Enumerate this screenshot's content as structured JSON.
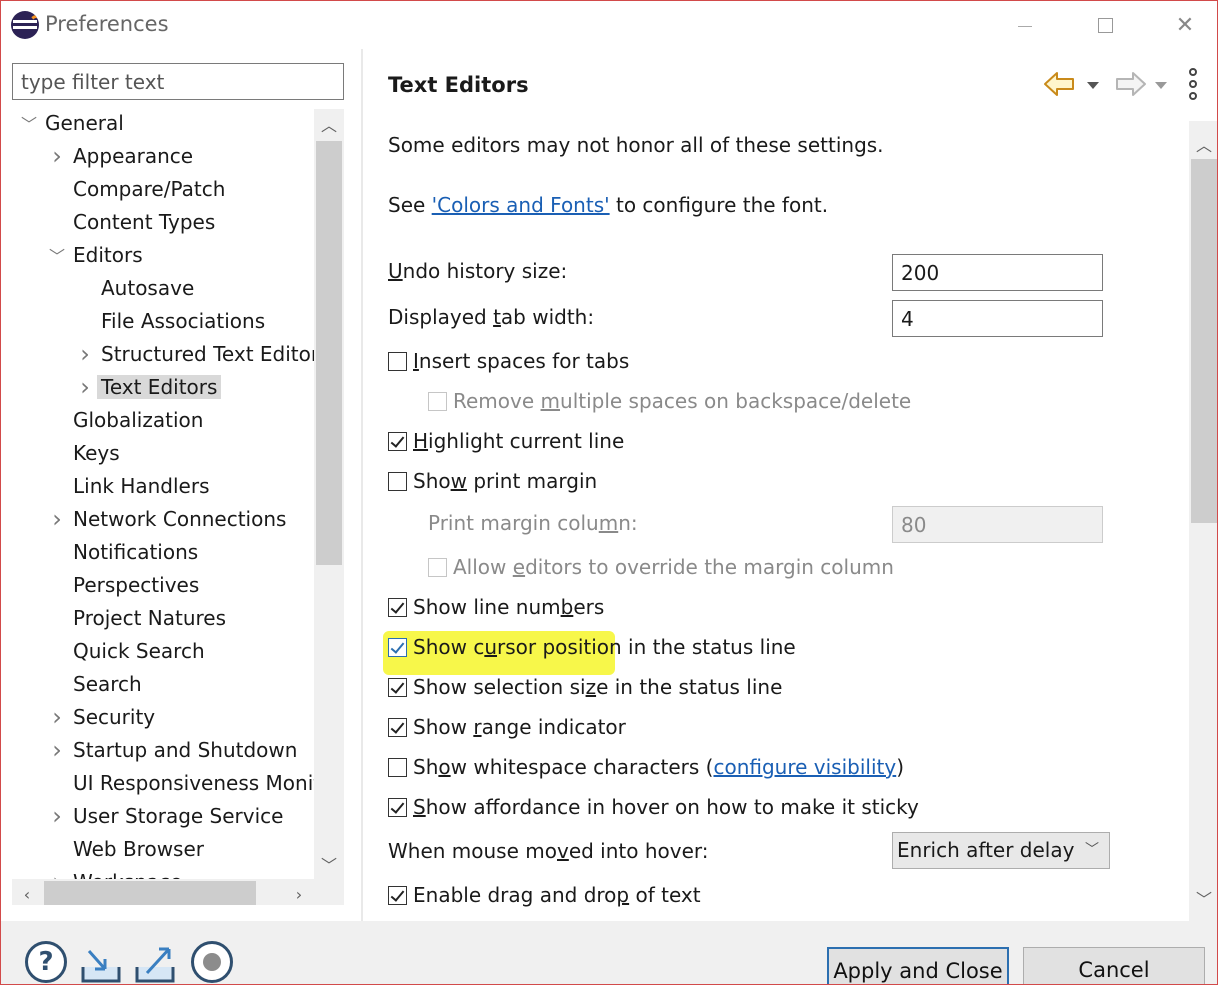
{
  "window": {
    "title": "Preferences"
  },
  "filter": {
    "placeholder": "type filter text"
  },
  "tree": {
    "items": [
      {
        "label": "General",
        "level": 0,
        "state": "expanded"
      },
      {
        "label": "Appearance",
        "level": 1,
        "state": "collapsed"
      },
      {
        "label": "Compare/Patch",
        "level": 1,
        "state": "leaf"
      },
      {
        "label": "Content Types",
        "level": 1,
        "state": "leaf"
      },
      {
        "label": "Editors",
        "level": 1,
        "state": "expanded"
      },
      {
        "label": "Autosave",
        "level": 2,
        "state": "leaf"
      },
      {
        "label": "File Associations",
        "level": 2,
        "state": "leaf"
      },
      {
        "label": "Structured Text Editors",
        "level": 2,
        "state": "collapsed"
      },
      {
        "label": "Text Editors",
        "level": 2,
        "state": "collapsed",
        "selected": true
      },
      {
        "label": "Globalization",
        "level": 1,
        "state": "leaf"
      },
      {
        "label": "Keys",
        "level": 1,
        "state": "leaf"
      },
      {
        "label": "Link Handlers",
        "level": 1,
        "state": "leaf"
      },
      {
        "label": "Network Connections",
        "level": 1,
        "state": "collapsed"
      },
      {
        "label": "Notifications",
        "level": 1,
        "state": "leaf"
      },
      {
        "label": "Perspectives",
        "level": 1,
        "state": "leaf"
      },
      {
        "label": "Project Natures",
        "level": 1,
        "state": "leaf"
      },
      {
        "label": "Quick Search",
        "level": 1,
        "state": "leaf"
      },
      {
        "label": "Search",
        "level": 1,
        "state": "leaf"
      },
      {
        "label": "Security",
        "level": 1,
        "state": "collapsed"
      },
      {
        "label": "Startup and Shutdown",
        "level": 1,
        "state": "collapsed"
      },
      {
        "label": "UI Responsiveness Monito",
        "level": 1,
        "state": "leaf"
      },
      {
        "label": "User Storage Service",
        "level": 1,
        "state": "collapsed"
      },
      {
        "label": "Web Browser",
        "level": 1,
        "state": "leaf"
      },
      {
        "label": "Workspace",
        "level": 1,
        "state": "collapsed"
      }
    ]
  },
  "page": {
    "title": "Text Editors",
    "intro": "Some editors may not honor all of these settings.",
    "see_prefix": "See ",
    "colors_link": "'Colors and Fonts'",
    "see_suffix": " to configure the font.",
    "undo_label_u": "U",
    "undo_label_rest": "ndo history size:",
    "undo_value": "200",
    "tab_label_pre": "Displayed ",
    "tab_label_u": "t",
    "tab_label_rest": "ab width:",
    "tab_value": "4",
    "insert_spaces_u": "I",
    "insert_spaces_rest": "nsert spaces for tabs",
    "insert_spaces_checked": false,
    "remove_spaces_pre": "Remove ",
    "remove_spaces_u": "m",
    "remove_spaces_rest": "ultiple spaces on backspace/delete",
    "remove_spaces_checked": false,
    "highlight_u": "H",
    "highlight_rest": "ighlight current line",
    "highlight_checked": true,
    "print_margin_pre": "Sho",
    "print_margin_u": "w",
    "print_margin_rest": " print margin",
    "print_margin_checked": false,
    "margin_col_pre": "Print margin colu",
    "margin_col_u": "m",
    "margin_col_rest": "n:",
    "margin_col_value": "80",
    "allow_override_pre": "Allow ",
    "allow_override_u": "e",
    "allow_override_rest": "ditors to override the margin column",
    "allow_override_checked": false,
    "line_numbers_pre": "Show line num",
    "line_numbers_u": "b",
    "line_numbers_rest": "ers",
    "line_numbers_checked": true,
    "cursor_pos_pre": "Show c",
    "cursor_pos_u": "u",
    "cursor_pos_rest": "rsor position in the status line",
    "cursor_pos_checked": true,
    "selection_size_pre": "Show selection si",
    "selection_size_u": "z",
    "selection_size_rest": "e in the status line",
    "selection_size_checked": true,
    "range_pre": "Show ",
    "range_u": "r",
    "range_rest": "ange indicator",
    "range_checked": true,
    "whitespace_pre": "Sh",
    "whitespace_u": "o",
    "whitespace_rest": "w whitespace characters (",
    "whitespace_link": "configure visibility",
    "whitespace_close": ")",
    "whitespace_checked": false,
    "affordance_u": "S",
    "affordance_rest": "how affordance in hover on how to make it sticky",
    "affordance_checked": true,
    "hover_pre": "When mouse mo",
    "hover_u": "v",
    "hover_rest": "ed into hover:",
    "hover_value": "Enrich after delay",
    "dnd_pre": "Enable drag and dro",
    "dnd_u": "p",
    "dnd_rest": " of text",
    "dnd_checked": true
  },
  "buttons": {
    "apply_close": "Apply and Close",
    "cancel": "Cancel"
  },
  "colors": {
    "highlight": "#f7f74a",
    "link": "#1a5fb4",
    "primary_border": "#2c6fb0"
  }
}
